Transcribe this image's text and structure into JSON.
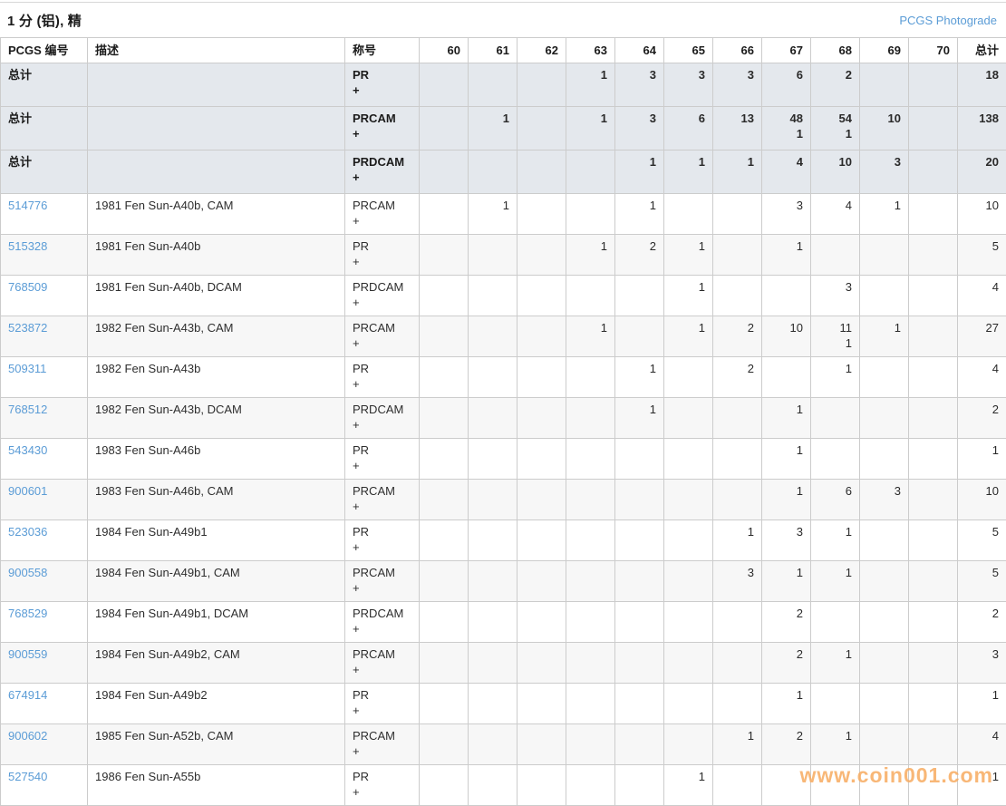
{
  "page": {
    "title": "1 分 (铝), 精",
    "photograde_link_label": "PCGS Photograde"
  },
  "colors": {
    "link_blue": "#5b9cd6",
    "summary_row_bg": "#e4e8ed",
    "alt_row_bg": "#f7f7f7",
    "border_gray": "#cccccc",
    "watermark_orange": "#f7aa5f"
  },
  "watermark": "www.coin001.com",
  "table": {
    "col_headers": {
      "pcgs": "PCGS 编号",
      "desc": "描述",
      "designation": "称号",
      "total": "总计"
    },
    "grade_labels": [
      "60",
      "61",
      "62",
      "63",
      "64",
      "65",
      "66",
      "67",
      "68",
      "69",
      "70"
    ],
    "summary_label": "总计",
    "summary_rows": [
      {
        "label": "总计",
        "description": "",
        "designation": "PR",
        "plus": "+",
        "counts": [
          "",
          "",
          "",
          "1",
          "3",
          "3",
          "3",
          "6",
          "2",
          "",
          ""
        ],
        "plus_counts": [
          "",
          "",
          "",
          "",
          "",
          "",
          "",
          "",
          "",
          "",
          ""
        ],
        "total": "18"
      },
      {
        "label": "总计",
        "description": "",
        "designation": "PRCAM",
        "plus": "+",
        "counts": [
          "",
          "1",
          "",
          "1",
          "3",
          "6",
          "13",
          "48",
          "54",
          "10",
          ""
        ],
        "plus_counts": [
          "",
          "",
          "",
          "",
          "",
          "",
          "",
          "1",
          "1",
          "",
          ""
        ],
        "total": "138"
      },
      {
        "label": "总计",
        "description": "",
        "designation": "PRDCAM",
        "plus": "+",
        "counts": [
          "",
          "",
          "",
          "",
          "1",
          "1",
          "1",
          "4",
          "10",
          "3",
          ""
        ],
        "plus_counts": [
          "",
          "",
          "",
          "",
          "",
          "",
          "",
          "",
          "",
          "",
          ""
        ],
        "total": "20"
      }
    ],
    "coin_rows": [
      {
        "pcgs": "514776",
        "description": "1981 Fen Sun-A40b, CAM",
        "designation": "PRCAM",
        "plus": "+",
        "counts": [
          "",
          "1",
          "",
          "",
          "1",
          "",
          "",
          "3",
          "4",
          "1",
          ""
        ],
        "plus_counts": [
          "",
          "",
          "",
          "",
          "",
          "",
          "",
          "",
          "",
          "",
          ""
        ],
        "total": "10"
      },
      {
        "pcgs": "515328",
        "description": "1981 Fen Sun-A40b",
        "designation": "PR",
        "plus": "+",
        "counts": [
          "",
          "",
          "",
          "1",
          "2",
          "1",
          "",
          "1",
          "",
          "",
          ""
        ],
        "plus_counts": [
          "",
          "",
          "",
          "",
          "",
          "",
          "",
          "",
          "",
          "",
          ""
        ],
        "total": "5"
      },
      {
        "pcgs": "768509",
        "description": "1981 Fen Sun-A40b, DCAM",
        "designation": "PRDCAM",
        "plus": "+",
        "counts": [
          "",
          "",
          "",
          "",
          "",
          "1",
          "",
          "",
          "3",
          "",
          ""
        ],
        "plus_counts": [
          "",
          "",
          "",
          "",
          "",
          "",
          "",
          "",
          "",
          "",
          ""
        ],
        "total": "4"
      },
      {
        "pcgs": "523872",
        "description": "1982 Fen Sun-A43b, CAM",
        "designation": "PRCAM",
        "plus": "+",
        "counts": [
          "",
          "",
          "",
          "1",
          "",
          "1",
          "2",
          "10",
          "11",
          "1",
          ""
        ],
        "plus_counts": [
          "",
          "",
          "",
          "",
          "",
          "",
          "",
          "",
          "1",
          "",
          ""
        ],
        "total": "27"
      },
      {
        "pcgs": "509311",
        "description": "1982 Fen Sun-A43b",
        "designation": "PR",
        "plus": "+",
        "counts": [
          "",
          "",
          "",
          "",
          "1",
          "",
          "2",
          "",
          "1",
          "",
          ""
        ],
        "plus_counts": [
          "",
          "",
          "",
          "",
          "",
          "",
          "",
          "",
          "",
          "",
          ""
        ],
        "total": "4"
      },
      {
        "pcgs": "768512",
        "description": "1982 Fen Sun-A43b, DCAM",
        "designation": "PRDCAM",
        "plus": "+",
        "counts": [
          "",
          "",
          "",
          "",
          "1",
          "",
          "",
          "1",
          "",
          "",
          ""
        ],
        "plus_counts": [
          "",
          "",
          "",
          "",
          "",
          "",
          "",
          "",
          "",
          "",
          ""
        ],
        "total": "2"
      },
      {
        "pcgs": "543430",
        "description": "1983 Fen Sun-A46b",
        "designation": "PR",
        "plus": "+",
        "counts": [
          "",
          "",
          "",
          "",
          "",
          "",
          "",
          "1",
          "",
          "",
          ""
        ],
        "plus_counts": [
          "",
          "",
          "",
          "",
          "",
          "",
          "",
          "",
          "",
          "",
          ""
        ],
        "total": "1"
      },
      {
        "pcgs": "900601",
        "description": "1983 Fen Sun-A46b, CAM",
        "designation": "PRCAM",
        "plus": "+",
        "counts": [
          "",
          "",
          "",
          "",
          "",
          "",
          "",
          "1",
          "6",
          "3",
          ""
        ],
        "plus_counts": [
          "",
          "",
          "",
          "",
          "",
          "",
          "",
          "",
          "",
          "",
          ""
        ],
        "total": "10"
      },
      {
        "pcgs": "523036",
        "description": "1984 Fen Sun-A49b1",
        "designation": "PR",
        "plus": "+",
        "counts": [
          "",
          "",
          "",
          "",
          "",
          "",
          "1",
          "3",
          "1",
          "",
          ""
        ],
        "plus_counts": [
          "",
          "",
          "",
          "",
          "",
          "",
          "",
          "",
          "",
          "",
          ""
        ],
        "total": "5"
      },
      {
        "pcgs": "900558",
        "description": "1984 Fen Sun-A49b1, CAM",
        "designation": "PRCAM",
        "plus": "+",
        "counts": [
          "",
          "",
          "",
          "",
          "",
          "",
          "3",
          "1",
          "1",
          "",
          ""
        ],
        "plus_counts": [
          "",
          "",
          "",
          "",
          "",
          "",
          "",
          "",
          "",
          "",
          ""
        ],
        "total": "5"
      },
      {
        "pcgs": "768529",
        "description": "1984 Fen Sun-A49b1, DCAM",
        "designation": "PRDCAM",
        "plus": "+",
        "counts": [
          "",
          "",
          "",
          "",
          "",
          "",
          "",
          "2",
          "",
          "",
          ""
        ],
        "plus_counts": [
          "",
          "",
          "",
          "",
          "",
          "",
          "",
          "",
          "",
          "",
          ""
        ],
        "total": "2"
      },
      {
        "pcgs": "900559",
        "description": "1984 Fen Sun-A49b2, CAM",
        "designation": "PRCAM",
        "plus": "+",
        "counts": [
          "",
          "",
          "",
          "",
          "",
          "",
          "",
          "2",
          "1",
          "",
          ""
        ],
        "plus_counts": [
          "",
          "",
          "",
          "",
          "",
          "",
          "",
          "",
          "",
          "",
          ""
        ],
        "total": "3"
      },
      {
        "pcgs": "674914",
        "description": "1984 Fen Sun-A49b2",
        "designation": "PR",
        "plus": "+",
        "counts": [
          "",
          "",
          "",
          "",
          "",
          "",
          "",
          "1",
          "",
          "",
          ""
        ],
        "plus_counts": [
          "",
          "",
          "",
          "",
          "",
          "",
          "",
          "",
          "",
          "",
          ""
        ],
        "total": "1"
      },
      {
        "pcgs": "900602",
        "description": "1985 Fen Sun-A52b, CAM",
        "designation": "PRCAM",
        "plus": "+",
        "counts": [
          "",
          "",
          "",
          "",
          "",
          "",
          "1",
          "2",
          "1",
          "",
          ""
        ],
        "plus_counts": [
          "",
          "",
          "",
          "",
          "",
          "",
          "",
          "",
          "",
          "",
          ""
        ],
        "total": "4"
      },
      {
        "pcgs": "527540",
        "description": "1986 Fen Sun-A55b",
        "designation": "PR",
        "plus": "+",
        "counts": [
          "",
          "",
          "",
          "",
          "",
          "1",
          "",
          "",
          "",
          "",
          ""
        ],
        "plus_counts": [
          "",
          "",
          "",
          "",
          "",
          "",
          "",
          "",
          "",
          "",
          ""
        ],
        "total": "1"
      }
    ]
  }
}
